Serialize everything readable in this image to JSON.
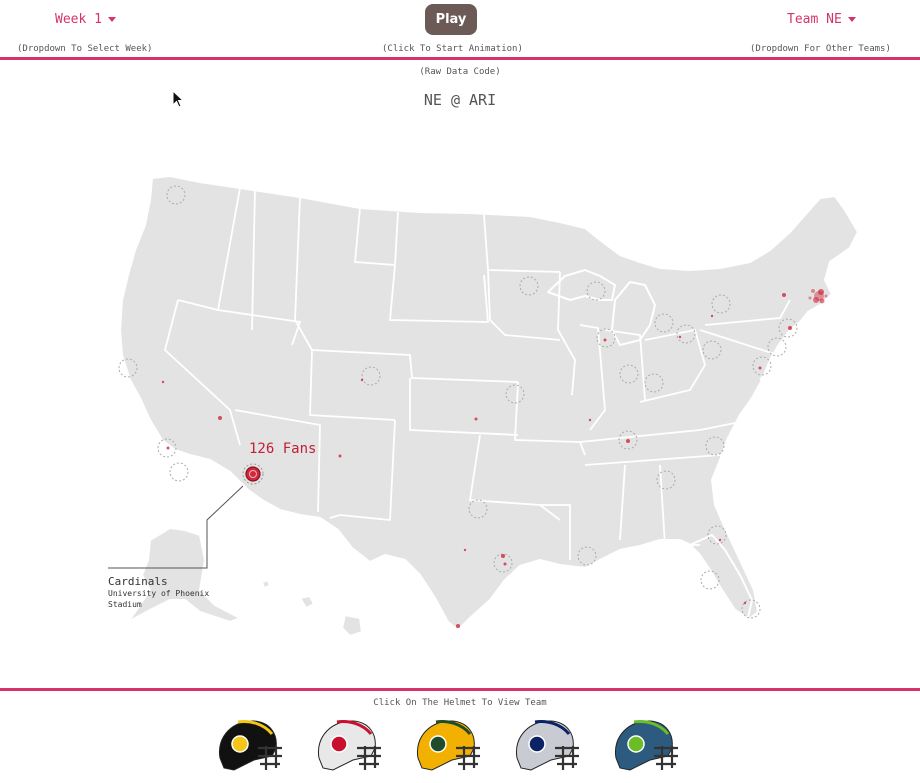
{
  "header": {
    "week_label": "Week 1",
    "week_hint": "(Dropdown To Select Week)",
    "play_label": "Play",
    "play_hint": "(Click To Start Animation)",
    "team_label": "Team NE",
    "team_hint": "(Dropdown For Other Teams)"
  },
  "raw_data_link": "(Raw Data Code)",
  "matchup_title": "NE @ ARI",
  "callout": {
    "fans": "126 Fans",
    "team": "Cardinals",
    "stadium": "University of Phoenix Stadium"
  },
  "footer": {
    "hint": "Click On The Helmet To View Team",
    "helmets": [
      {
        "team": "steelers",
        "shell": "#111111",
        "stripe": "#f5c518",
        "logo": "steelers-logo-icon"
      },
      {
        "team": "patriots",
        "shell": "#e8e8e8",
        "stripe": "#c8102e",
        "logo": "patriots-logo-icon"
      },
      {
        "team": "packers",
        "shell": "#f2b100",
        "stripe": "#1f4d2b",
        "logo": "packers-logo-icon"
      },
      {
        "team": "cowboys",
        "shell": "#c8ccd2",
        "stripe": "#0b2265",
        "logo": "cowboys-logo-icon"
      },
      {
        "team": "seahawks",
        "shell": "#2d5b7f",
        "stripe": "#69be28",
        "logo": "seahawks-logo-icon"
      }
    ]
  },
  "colors": {
    "accent": "#d6336c",
    "map_fill": "#e3e3e3",
    "fan_dot": "#d0283c"
  }
}
